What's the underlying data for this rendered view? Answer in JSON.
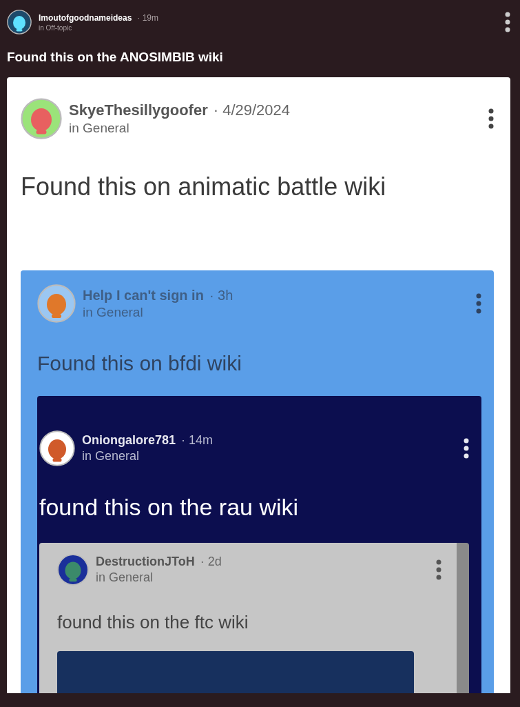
{
  "post": {
    "kind": "dark",
    "author": "Imoutofgoodnameideas",
    "time": "· 19m",
    "category": "in Off-topic",
    "title": "Found this on the ANOSIMBIB wiki",
    "embed": {
      "kind": "light",
      "author": "SkyeThesillygoofer",
      "time": "· 4/29/2024",
      "category": "in General",
      "title": "Found this on animatic battle wiki",
      "embed": {
        "kind": "blue",
        "author": "Help I can't sign in",
        "time": "· 3h",
        "category": "in General",
        "title": "Found this on bfdi wiki",
        "embed": {
          "kind": "navy",
          "author": "Oniongalore781",
          "time": "· 14m",
          "category": "in General",
          "title": "found this on the rau wiki",
          "embed": {
            "kind": "grey",
            "author": "DestructionJToH",
            "time": "· 2d",
            "category": "in General",
            "title": "found this on the ftc wiki",
            "embed": {
              "kind": "deep"
            }
          }
        }
      }
    }
  }
}
